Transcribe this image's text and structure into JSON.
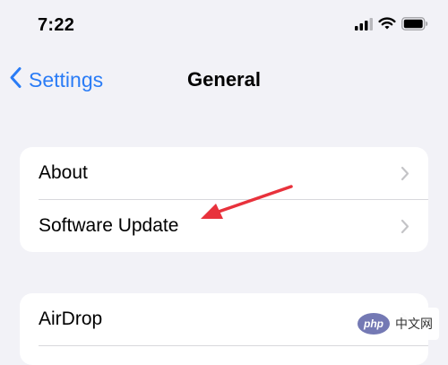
{
  "status_bar": {
    "time": "7:22"
  },
  "nav": {
    "back_label": "Settings",
    "title": "General"
  },
  "group_1": {
    "rows": [
      {
        "label": "About"
      },
      {
        "label": "Software Update"
      }
    ]
  },
  "group_2": {
    "rows": [
      {
        "label": "AirDrop"
      }
    ]
  },
  "annotation": {
    "arrow_color": "#e8323c",
    "target": "Software Update"
  },
  "watermark": {
    "logo_text": "php",
    "text": "中文网"
  },
  "colors": {
    "background": "#f2f2f7",
    "accent": "#2a7cf6",
    "card": "#ffffff",
    "chevron": "#c4c4c7"
  }
}
